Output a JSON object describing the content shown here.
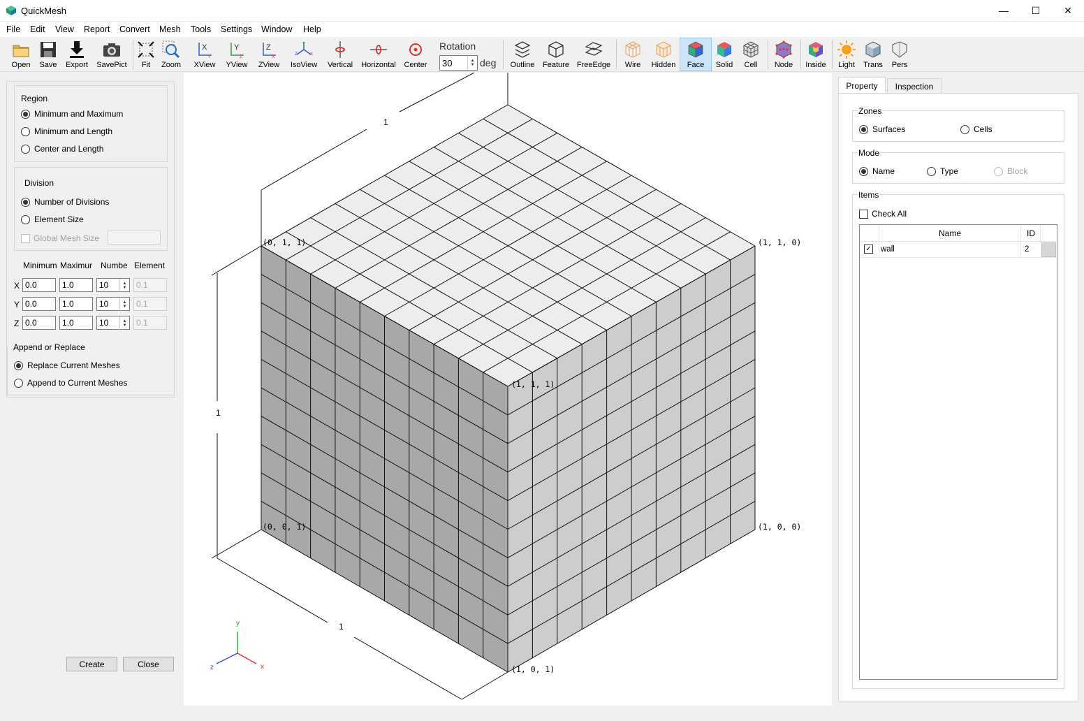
{
  "window": {
    "title": "QuickMesh",
    "controls": {
      "minimize": "—",
      "maximize": "☐",
      "close": "✕"
    }
  },
  "menu": [
    "File",
    "Edit",
    "View",
    "Report",
    "Convert",
    "Mesh",
    "Tools",
    "Settings",
    "Window",
    "Help"
  ],
  "toolbar": {
    "buttons": [
      {
        "label": "Open",
        "icon": "folder-icon"
      },
      {
        "label": "Save",
        "icon": "floppy-icon"
      },
      {
        "label": "Export",
        "icon": "download-icon"
      },
      {
        "label": "SavePict",
        "icon": "camera-icon"
      },
      {
        "label": "Fit",
        "icon": "fit-icon"
      },
      {
        "label": "Zoom",
        "icon": "zoom-icon"
      },
      {
        "label": "XView",
        "icon": "xview-icon"
      },
      {
        "label": "YView",
        "icon": "yview-icon"
      },
      {
        "label": "ZView",
        "icon": "zview-icon"
      },
      {
        "label": "IsoView",
        "icon": "isoview-icon"
      },
      {
        "label": "Vertical",
        "icon": "vertical-rotate-icon"
      },
      {
        "label": "Horizontal",
        "icon": "horizontal-rotate-icon"
      },
      {
        "label": "Center",
        "icon": "center-icon"
      },
      {
        "label": "Outline",
        "icon": "outline-icon"
      },
      {
        "label": "Feature",
        "icon": "feature-icon"
      },
      {
        "label": "FreeEdge",
        "icon": "freeedge-icon"
      },
      {
        "label": "Wire",
        "icon": "wire-icon"
      },
      {
        "label": "Hidden",
        "icon": "hidden-icon"
      },
      {
        "label": "Face",
        "icon": "face-icon",
        "active": true
      },
      {
        "label": "Solid",
        "icon": "solid-icon"
      },
      {
        "label": "Cell",
        "icon": "cell-icon"
      },
      {
        "label": "Node",
        "icon": "node-icon"
      },
      {
        "label": "Inside",
        "icon": "inside-icon"
      },
      {
        "label": "Light",
        "icon": "light-icon"
      },
      {
        "label": "Trans",
        "icon": "trans-icon"
      },
      {
        "label": "Pers",
        "icon": "pers-icon"
      }
    ],
    "rotation": {
      "label": "Rotation",
      "value": "30",
      "unit": "deg"
    }
  },
  "left_panel": {
    "region": {
      "title": "Region",
      "options": [
        "Minimum and Maximum",
        "Minimum and Length",
        "Center and Length"
      ],
      "selected": 0
    },
    "division": {
      "title": "Division",
      "options": [
        "Number of Divisions",
        "Element Size"
      ],
      "selected": 0,
      "global_mesh_size_label": "Global Mesh Size",
      "global_mesh_size_value": ""
    },
    "table": {
      "headers": [
        "Minimum",
        "Maximur",
        "Numbe",
        "Element"
      ],
      "rows": [
        {
          "axis": "X",
          "min": "0.0",
          "max": "1.0",
          "num": "10",
          "elem": "0.1"
        },
        {
          "axis": "Y",
          "min": "0.0",
          "max": "1.0",
          "num": "10",
          "elem": "0.1"
        },
        {
          "axis": "Z",
          "min": "0.0",
          "max": "1.0",
          "num": "10",
          "elem": "0.1"
        }
      ]
    },
    "append": {
      "title": "Append or Replace",
      "options": [
        "Replace Current Meshes",
        "Append to Current Meshes"
      ],
      "selected": 0
    },
    "buttons": {
      "create": "Create",
      "close": "Close"
    }
  },
  "viewport": {
    "corner_labels": {
      "p010": "(0, 1, 1)",
      "p110": "(1, 1, 0)",
      "p111": "(1, 1, 1)",
      "p001": "(0, 0, 1)",
      "p100": "(1, 0, 0)",
      "p101": "(1, 0, 1)"
    },
    "dimension_labels": {
      "top": "1",
      "left": "1",
      "bottom": "1"
    },
    "axes": {
      "x": "x",
      "y": "y",
      "z": "z"
    },
    "colors": {
      "top_face": "#ededed",
      "front_face": "#cdcdcd",
      "left_face": "#a8a8a8",
      "grid": "#111111"
    }
  },
  "right_panel": {
    "tabs": [
      "Property",
      "Inspection"
    ],
    "active_tab": 0,
    "zones": {
      "title": "Zones",
      "options": [
        "Surfaces",
        "Cells"
      ],
      "selected": 0
    },
    "mode": {
      "title": "Mode",
      "options": [
        "Name",
        "Type",
        "Block"
      ],
      "selected": 0
    },
    "items": {
      "title": "Items",
      "check_all": "Check All",
      "headers": [
        "Name",
        "ID"
      ],
      "rows": [
        {
          "checked": true,
          "name": "wall",
          "id": "2"
        }
      ]
    }
  }
}
